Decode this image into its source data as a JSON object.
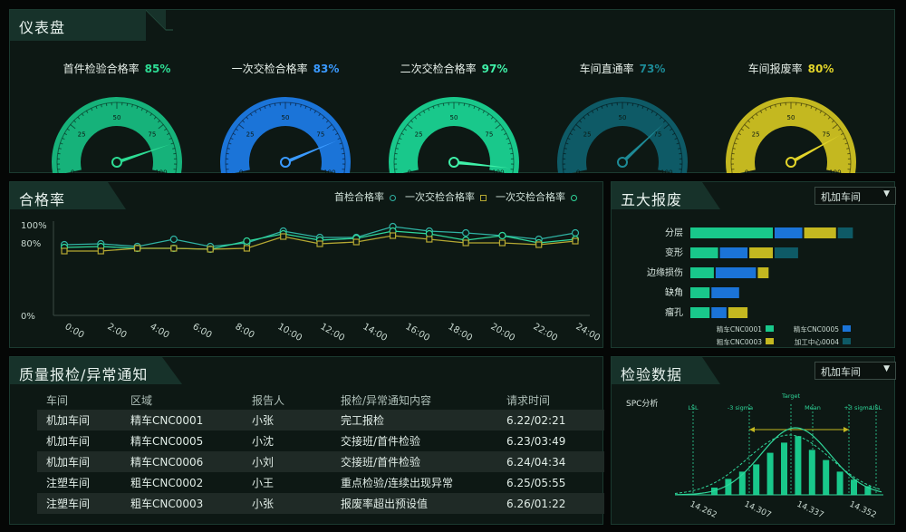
{
  "dashboard": {
    "title": "仪表盘",
    "gauges": [
      {
        "label": "首件检验合格率",
        "value_text": "85%",
        "value": 85,
        "color": "#16b27a",
        "text_color": "#2ddc94"
      },
      {
        "label": "一次交检合格率",
        "value_text": "83%",
        "value": 83,
        "color": "#1b74d8",
        "text_color": "#3a9aff"
      },
      {
        "label": "二次交检合格率",
        "value_text": "97%",
        "value": 97,
        "color": "#19c88b",
        "text_color": "#3ff0a8"
      },
      {
        "label": "车间直通率",
        "value_text": "73%",
        "value": 73,
        "color": "#0e5a66",
        "text_color": "#1d8a96"
      },
      {
        "label": "车间报废率",
        "value_text": "80%",
        "value": 80,
        "color": "#c4b820",
        "text_color": "#e2d42a"
      }
    ],
    "ticks": [
      "0",
      "25",
      "50",
      "75",
      "100"
    ]
  },
  "pass_rate": {
    "title": "合格率",
    "legend": [
      "首检合格率",
      "一次交检合格率",
      "一次交检合格率"
    ],
    "chart_data": {
      "type": "line",
      "x": [
        "0:00",
        "2:00",
        "4:00",
        "6:00",
        "8:00",
        "10:00",
        "12:00",
        "14:00",
        "16:00",
        "18:00",
        "20:00",
        "22:00",
        "24:00"
      ],
      "yticks": [
        "100%",
        "80%",
        "0%"
      ],
      "ylim": [
        0,
        100
      ],
      "series": [
        {
          "name": "首检合格率",
          "color": "#2fb2a3",
          "values": [
            78,
            79,
            76,
            84,
            76,
            80,
            93,
            86,
            86,
            98,
            93,
            91,
            88,
            84,
            91
          ]
        },
        {
          "name": "一次交检合格率",
          "color": "#2fd69a",
          "values": [
            75,
            76,
            74,
            74,
            73,
            82,
            90,
            83,
            85,
            93,
            90,
            83,
            88,
            80,
            84
          ]
        },
        {
          "name": "一次交检合格率",
          "color": "#b5a832",
          "values": [
            71,
            71,
            74,
            74,
            73,
            74,
            87,
            79,
            81,
            88,
            84,
            80,
            80,
            78,
            82
          ]
        }
      ]
    }
  },
  "scrap": {
    "title": "五大报废",
    "select": "机加车间",
    "chart_data": {
      "type": "bar",
      "categories": [
        "分层",
        "变形",
        "边缘损伤",
        "缺角",
        "瘤孔"
      ],
      "series": [
        {
          "name": "精车CNC0001",
          "color": "#19c88b",
          "values": [
            10,
            3.5,
            3,
            2.5,
            2.5
          ]
        },
        {
          "name": "精车CNC0005",
          "color": "#1b74d8",
          "values": [
            3.5,
            3.5,
            5,
            3.5,
            2
          ]
        },
        {
          "name": "粗车CNC0003",
          "color": "#c4b820",
          "values": [
            4,
            3,
            1.5,
            0,
            2.5
          ]
        },
        {
          "name": "加工中心0004",
          "color": "#0e5a66",
          "values": [
            2,
            3,
            0,
            0,
            0
          ]
        }
      ]
    }
  },
  "notices": {
    "title": "质量报检/异常通知",
    "columns": [
      "车间",
      "区域",
      "报告人",
      "报检/异常通知内容",
      "请求时间"
    ],
    "rows": [
      [
        "机加车间",
        "精车CNC0001",
        "小张",
        "完工报检",
        "6.22/02:21"
      ],
      [
        "机加车间",
        "精车CNC0005",
        "小沈",
        "交接班/首件检验",
        "6.23/03:49"
      ],
      [
        "机加车间",
        "精车CNC0006",
        "小刘",
        "交接班/首件检验",
        "6.24/04:34"
      ],
      [
        "注塑车间",
        "粗车CNC0002",
        "小王",
        "重点检验/连续出现异常",
        "6.25/05:55"
      ],
      [
        "注塑车间",
        "粗车CNC0003",
        "小张",
        "报废率超出预设值",
        "6.26/01:22"
      ]
    ]
  },
  "inspection": {
    "title": "检验数据",
    "select": "机加车间",
    "spc_label": "SPC分析",
    "markers": {
      "lsl": "LSL",
      "minus3": "-3 sigma",
      "target": "Target",
      "mean": "Mean",
      "plus3": "+3 sigma",
      "usl": "USL"
    },
    "chart_data": {
      "type": "bar",
      "x_ticks": [
        "14.262",
        "14.307",
        "14.337",
        "14.352"
      ],
      "values": [
        1,
        2.2,
        3.2,
        4.2,
        5.8,
        7.2,
        8.1,
        6.2,
        4.8,
        3.2,
        2.1,
        1.2
      ],
      "ylim": [
        0,
        9
      ],
      "color": "#19c88b"
    }
  }
}
